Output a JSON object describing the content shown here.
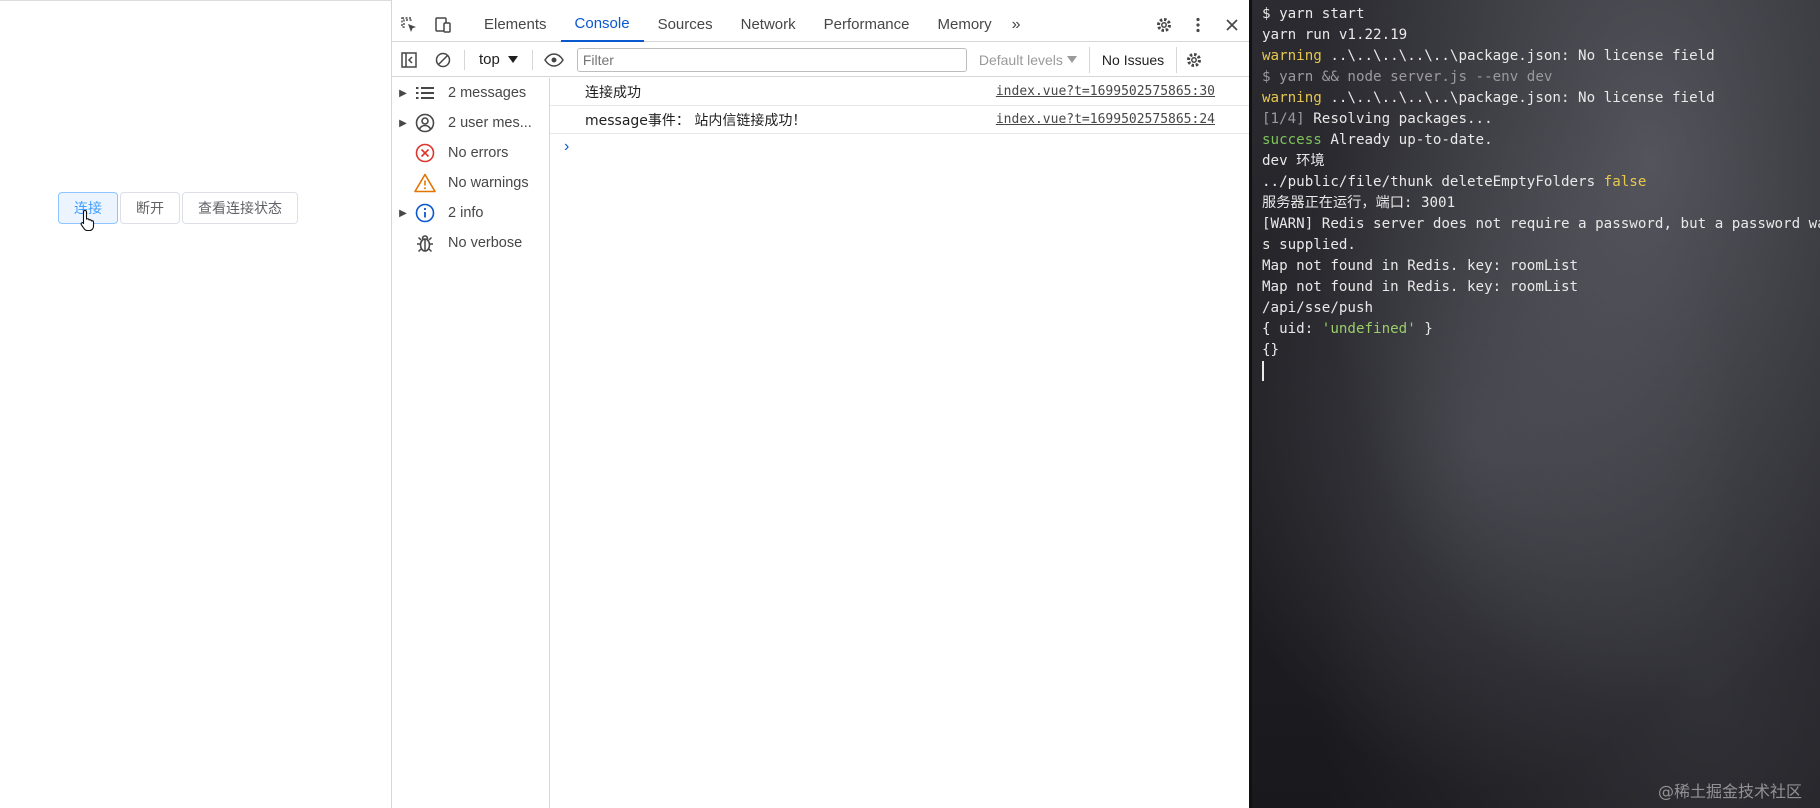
{
  "page": {
    "buttons": [
      {
        "label": "连接"
      },
      {
        "label": "断开"
      },
      {
        "label": "查看连接状态"
      }
    ]
  },
  "devtools": {
    "tabs": [
      "Elements",
      "Console",
      "Sources",
      "Network",
      "Performance",
      "Memory"
    ],
    "active_tab": "Console",
    "toolbar": {
      "context": "top",
      "filter_placeholder": "Filter",
      "levels": "Default levels",
      "issues": "No Issues"
    },
    "sidebar": [
      {
        "label": "2 messages",
        "icon": "list-icon",
        "expandable": true
      },
      {
        "label": "2 user mes...",
        "icon": "user-icon",
        "expandable": true
      },
      {
        "label": "No errors",
        "icon": "error-icon",
        "expandable": false
      },
      {
        "label": "No warnings",
        "icon": "warning-icon",
        "expandable": false
      },
      {
        "label": "2 info",
        "icon": "info-icon",
        "expandable": true
      },
      {
        "label": "No verbose",
        "icon": "bug-icon",
        "expandable": false
      }
    ],
    "logs": [
      {
        "message": "连接成功",
        "source": "index.vue?t=1699502575865:30"
      },
      {
        "message": "message事件： 站内信链接成功！",
        "source": "index.vue?t=1699502575865:24"
      }
    ]
  },
  "terminal": {
    "lines": [
      [
        {
          "t": "$ yarn start",
          "c": ""
        }
      ],
      [
        {
          "t": "yarn run v1.22.19",
          "c": ""
        }
      ],
      [
        {
          "t": "warning",
          "c": "t-yellow"
        },
        {
          "t": " ..\\..\\..\\..\\..\\package.json: No license field",
          "c": ""
        }
      ],
      [
        {
          "t": "$ yarn && node server.js --env dev",
          "c": "t-dim"
        }
      ],
      [
        {
          "t": "warning",
          "c": "t-yellow"
        },
        {
          "t": " ..\\..\\..\\..\\..\\package.json: No license field",
          "c": ""
        }
      ],
      [
        {
          "t": "[1/4]",
          "c": "t-dim"
        },
        {
          "t": " Resolving packages...",
          "c": ""
        }
      ],
      [
        {
          "t": "success",
          "c": "t-green"
        },
        {
          "t": " Already up-to-date.",
          "c": ""
        }
      ],
      [
        {
          "t": "dev 环境",
          "c": ""
        }
      ],
      [
        {
          "t": "../public/file/thunk deleteEmptyFolders ",
          "c": ""
        },
        {
          "t": "false",
          "c": "t-yellow"
        }
      ],
      [
        {
          "t": "服务器正在运行，端口: 3001",
          "c": ""
        }
      ],
      [
        {
          "t": "[WARN] Redis server does not require a password, but a password wa",
          "c": ""
        }
      ],
      [
        {
          "t": "s supplied.",
          "c": ""
        }
      ],
      [
        {
          "t": "Map not found in Redis. key: roomList",
          "c": ""
        }
      ],
      [
        {
          "t": "Map not found in Redis. key: roomList",
          "c": ""
        }
      ],
      [
        {
          "t": "/api/sse/push",
          "c": ""
        }
      ],
      [
        {
          "t": "{ uid: ",
          "c": ""
        },
        {
          "t": "'undefined'",
          "c": "t-str"
        },
        {
          "t": " }",
          "c": ""
        }
      ],
      [
        {
          "t": "{}",
          "c": ""
        }
      ]
    ],
    "watermark": "@稀土掘金技术社区"
  }
}
